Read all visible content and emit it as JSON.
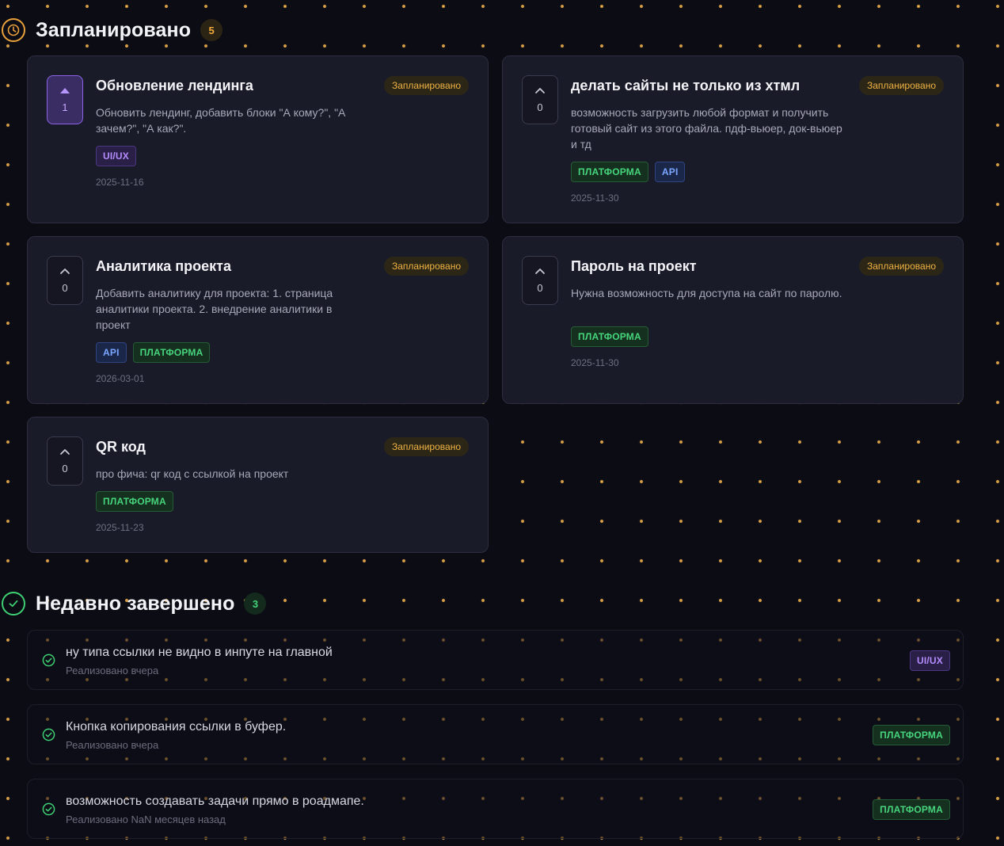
{
  "planned": {
    "title": "Запланировано",
    "count": "5",
    "cards": [
      {
        "votes": "1",
        "voted": true,
        "title": "Обновление лендинга",
        "status": "Запланировано",
        "description": "Обновить лендинг, добавить блоки \"А кому?\", \"А зачем?\", \"А как?\".",
        "tags": [
          "UI/UX"
        ],
        "date": "2025-11-16"
      },
      {
        "votes": "0",
        "voted": false,
        "title": "делать сайты не только из хтмл",
        "status": "Запланировано",
        "description": "возможность загрузить любой формат и получить готовый сайт из этого файла. пдф-вьюер, док-вьюер и тд",
        "tags": [
          "ПЛАТФОРМА",
          "API"
        ],
        "date": "2025-11-30"
      },
      {
        "votes": "0",
        "voted": false,
        "title": "Аналитика проекта",
        "status": "Запланировано",
        "description": "Добавить аналитику для проекта: 1. страница аналитики проекта. 2. внедрение аналитики в проект",
        "tags": [
          "API",
          "ПЛАТФОРМА"
        ],
        "date": "2026-03-01"
      },
      {
        "votes": "0",
        "voted": false,
        "title": "Пароль на проект",
        "status": "Запланировано",
        "description": "Нужна возможность для доступа на сайт по паролю.",
        "tags": [
          "ПЛАТФОРМА"
        ],
        "date": "2025-11-30"
      },
      {
        "votes": "0",
        "voted": false,
        "title": "QR код",
        "status": "Запланировано",
        "description": "про фича: qr код с ссылкой на проект",
        "tags": [
          "ПЛАТФОРМА"
        ],
        "date": "2025-11-23"
      }
    ]
  },
  "completed": {
    "title": "Недавно завершено",
    "count": "3",
    "items": [
      {
        "title": "ну типа ссылки не видно в инпуте на главной",
        "subtitle": "Реализовано вчера",
        "tag": "UI/UX"
      },
      {
        "title": "Кнопка копирования ссылки в буфер.",
        "subtitle": "Реализовано вчера",
        "tag": "ПЛАТФОРМА"
      },
      {
        "title": "возможность создавать задачи прямо в роадмапе.",
        "subtitle": "Реализовано NaN месяцев назад",
        "tag": "ПЛАТФОРМА"
      }
    ]
  },
  "colors": {
    "accent_amber": "#f0a93a",
    "accent_green": "#3ecf73",
    "accent_purple": "#8a63e6",
    "card_bg": "#1a1b28",
    "page_bg": "#0b0c14"
  }
}
